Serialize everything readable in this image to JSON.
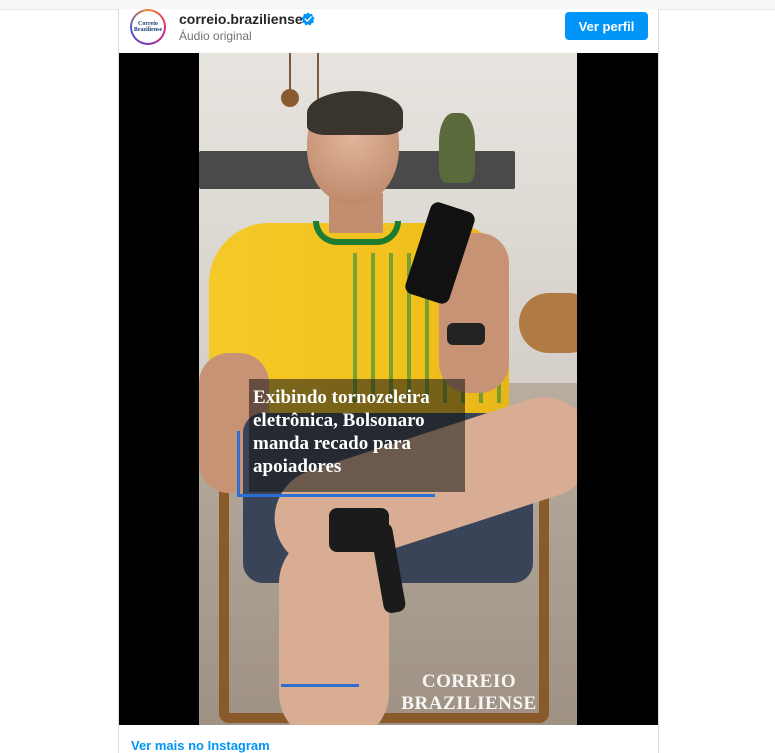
{
  "post": {
    "avatar_text": "Correio Braziliense",
    "username": "correio.braziliense",
    "subtitle": "Áudio original",
    "follow_button": "Ver perfil",
    "footer_link": "Ver mais no Instagram",
    "verified_icon": "verified-badge-icon",
    "accent_color": "#0095f6"
  },
  "video": {
    "caption": "Exibindo tornozeleira eletrônica, Bolsonaro manda recado para apoiadores",
    "brand": "CORREIO BRAZILIENSE",
    "accent_line_color": "#2c6fd0"
  }
}
